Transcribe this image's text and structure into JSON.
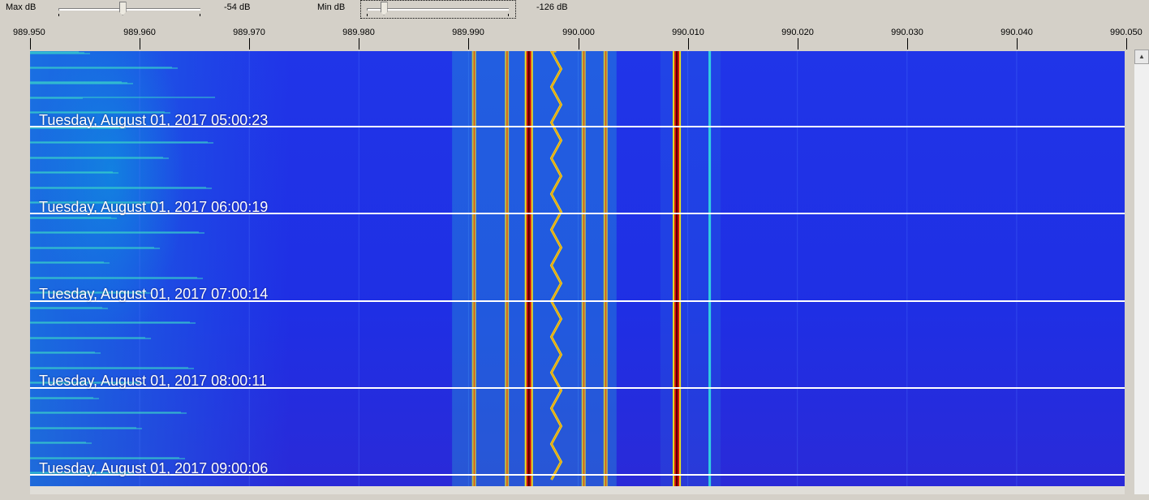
{
  "toolbar": {
    "max_db": {
      "label": "Max dB",
      "value": "-54 dB",
      "position": 0.45
    },
    "min_db": {
      "label": "Min dB",
      "value": "-126 dB",
      "position": 0.1
    }
  },
  "frequency_axis": {
    "labels": [
      "989.950",
      "989.960",
      "989.970",
      "989.980",
      "989.990",
      "990.000",
      "990.010",
      "990.020",
      "990.030",
      "990.040",
      "990.050"
    ],
    "min": 989.95,
    "max": 990.05
  },
  "waterfall": {
    "timestamps": [
      "Tuesday, August 01, 2017 05:00:23",
      "Tuesday, August 01, 2017 06:00:19",
      "Tuesday, August 01, 2017 07:00:14",
      "Tuesday, August 01, 2017 08:00:11",
      "Tuesday, August 01, 2017 09:00:06"
    ],
    "signals": [
      {
        "freq": 989.9905,
        "strength": "medium"
      },
      {
        "freq": 989.9935,
        "strength": "medium"
      },
      {
        "freq": 989.9955,
        "strength": "strong"
      },
      {
        "freq": 989.998,
        "strength": "zigzag"
      },
      {
        "freq": 990.0005,
        "strength": "medium"
      },
      {
        "freq": 990.0025,
        "strength": "medium"
      },
      {
        "freq": 990.009,
        "strength": "strong"
      },
      {
        "freq": 990.012,
        "strength": "weak"
      }
    ],
    "colors": {
      "background": "#1f2fe4",
      "weak": "#30d0e0",
      "medium": "#e8e020",
      "strong": "#d01010",
      "core": "#500000"
    }
  },
  "scrollbar": {
    "up_arrow": "▲"
  }
}
